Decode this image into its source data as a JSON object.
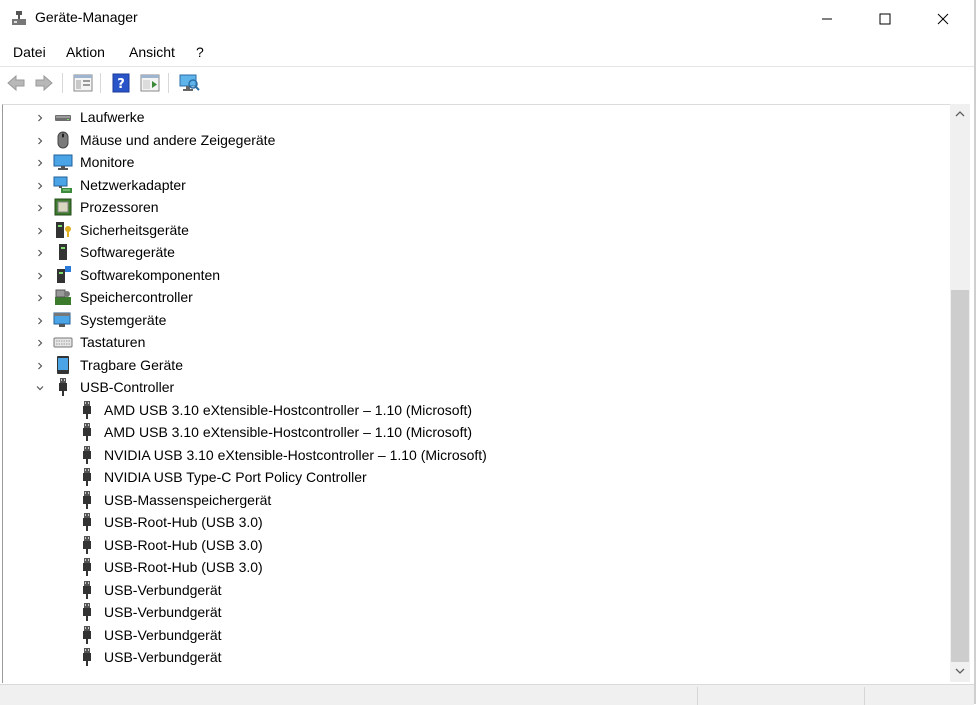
{
  "window": {
    "title": "Geräte-Manager"
  },
  "menu": {
    "items": [
      "Datei",
      "Aktion",
      "Ansicht",
      "?"
    ]
  },
  "toolbar": {
    "buttons": [
      "back-icon",
      "forward-icon",
      "tree-view-icon",
      "help-icon",
      "properties-icon",
      "monitor-icon"
    ]
  },
  "tree": {
    "categories": [
      {
        "label": "Laufwerke",
        "icon": "drive-icon"
      },
      {
        "label": "Mäuse und andere Zeigegeräte",
        "icon": "mouse-icon"
      },
      {
        "label": "Monitore",
        "icon": "monitor-icon"
      },
      {
        "label": "Netzwerkadapter",
        "icon": "network-adapter-icon"
      },
      {
        "label": "Prozessoren",
        "icon": "processor-icon"
      },
      {
        "label": "Sicherheitsgeräte",
        "icon": "security-device-icon"
      },
      {
        "label": "Softwaregeräte",
        "icon": "software-device-icon"
      },
      {
        "label": "Softwarekomponenten",
        "icon": "software-component-icon"
      },
      {
        "label": "Speichercontroller",
        "icon": "storage-controller-icon"
      },
      {
        "label": "Systemgeräte",
        "icon": "system-device-icon"
      },
      {
        "label": "Tastaturen",
        "icon": "keyboard-icon"
      },
      {
        "label": "Tragbare Geräte",
        "icon": "portable-device-icon"
      },
      {
        "label": "USB-Controller",
        "icon": "usb-icon",
        "expanded": true
      }
    ],
    "usb_children": [
      "AMD USB 3.10 eXtensible-Hostcontroller – 1.10 (Microsoft)",
      "AMD USB 3.10 eXtensible-Hostcontroller – 1.10 (Microsoft)",
      "NVIDIA USB 3.10 eXtensible-Hostcontroller – 1.10 (Microsoft)",
      "NVIDIA USB Type-C Port Policy Controller",
      "USB-Massenspeichergerät",
      "USB-Root-Hub (USB 3.0)",
      "USB-Root-Hub (USB 3.0)",
      "USB-Root-Hub (USB 3.0)",
      "USB-Verbundgerät",
      "USB-Verbundgerät",
      "USB-Verbundgerät",
      "USB-Verbundgerät"
    ]
  },
  "colors": {
    "accent": "#0078d7",
    "selection": "#cce8ff",
    "scrollbar_thumb": "#cdcdcd"
  }
}
